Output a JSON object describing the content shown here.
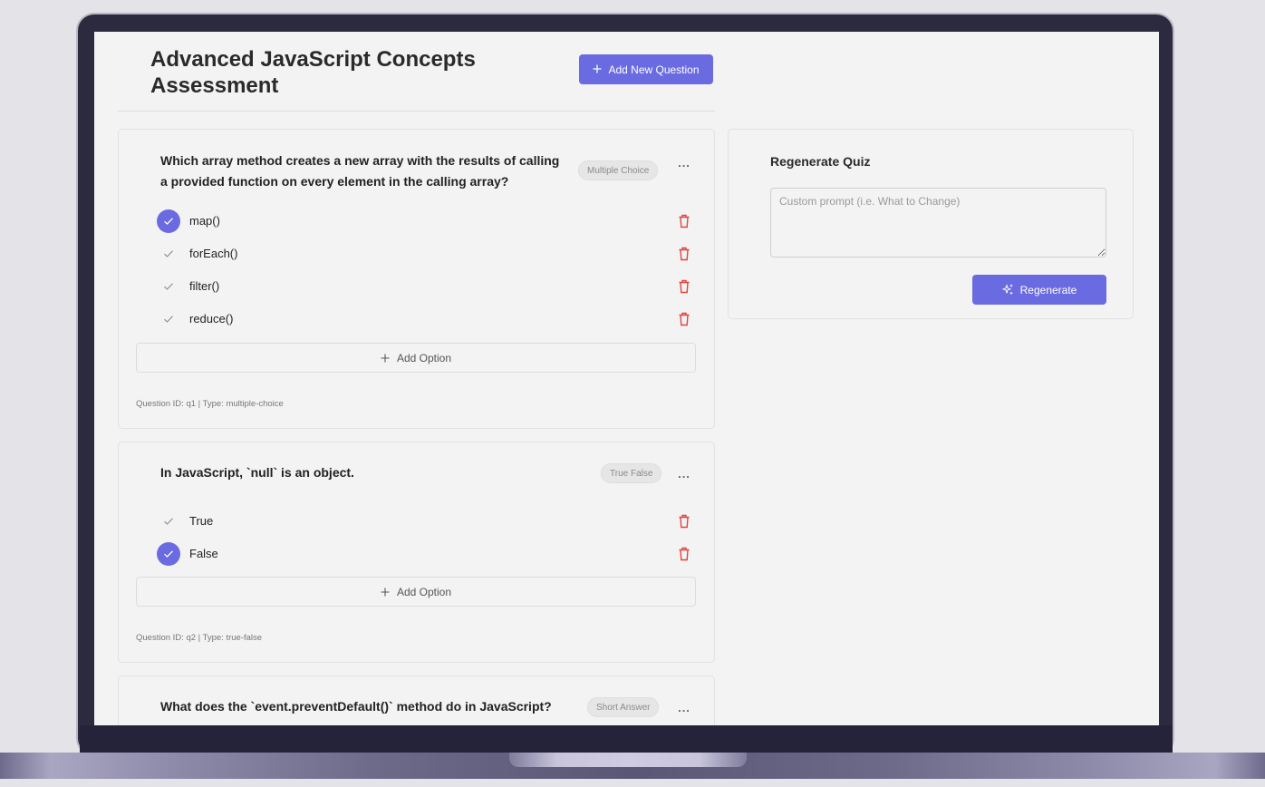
{
  "header": {
    "title": "Advanced JavaScript Concepts Assessment",
    "add_question_label": "Add New Question"
  },
  "questions": [
    {
      "text": "Which array method creates a new array with the results of calling a provided function on every element in the calling array?",
      "badge": "Multiple Choice",
      "more": "...",
      "options": [
        {
          "label": "map()",
          "correct": true
        },
        {
          "label": "forEach()",
          "correct": false
        },
        {
          "label": "filter()",
          "correct": false
        },
        {
          "label": "reduce()",
          "correct": false
        }
      ],
      "add_option_label": "Add Option",
      "meta": "Question ID: q1 | Type: multiple-choice"
    },
    {
      "text": "In JavaScript, `null` is an object.",
      "badge": "True False",
      "more": "...",
      "options": [
        {
          "label": "True",
          "correct": false
        },
        {
          "label": "False",
          "correct": true
        }
      ],
      "add_option_label": "Add Option",
      "meta": "Question ID: q2 | Type: true-false"
    },
    {
      "text": "What does the `event.preventDefault()` method do in JavaScript?",
      "badge": "Short Answer",
      "more": "..."
    }
  ],
  "regenerate": {
    "title": "Regenerate Quiz",
    "placeholder": "Custom prompt (i.e. What to Change)",
    "button_label": "Regenerate"
  },
  "colors": {
    "accent": "#6a6be0",
    "delete": "#e0453f",
    "page_background": "#f3f3f3",
    "frame": "#2c2a3e"
  }
}
